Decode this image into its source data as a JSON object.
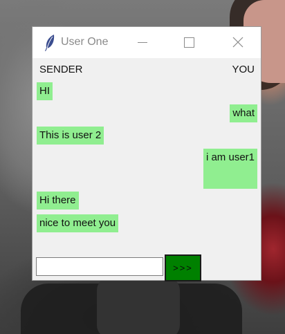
{
  "window": {
    "title": "User One",
    "icon": "feather-icon"
  },
  "controls": {
    "minimize_icon": "minimize-icon",
    "maximize_icon": "maximize-icon",
    "close_icon": "close-icon",
    "close_glyph": "✕"
  },
  "chat": {
    "sender_label": "SENDER",
    "you_label": "YOU",
    "messages": [
      {
        "side": "sender",
        "text": "HI"
      },
      {
        "side": "you",
        "text": "what"
      },
      {
        "side": "sender",
        "text": "This is user 2"
      },
      {
        "side": "you",
        "text": "i am user1"
      },
      {
        "side": "sender",
        "text": "Hi there"
      },
      {
        "side": "sender",
        "text": "nice to meet you"
      }
    ]
  },
  "composer": {
    "input_value": "",
    "send_label": ">>>"
  },
  "colors": {
    "bubble": "#90ee90",
    "send_button": "#008000",
    "window_bg": "#f0f0f0"
  }
}
